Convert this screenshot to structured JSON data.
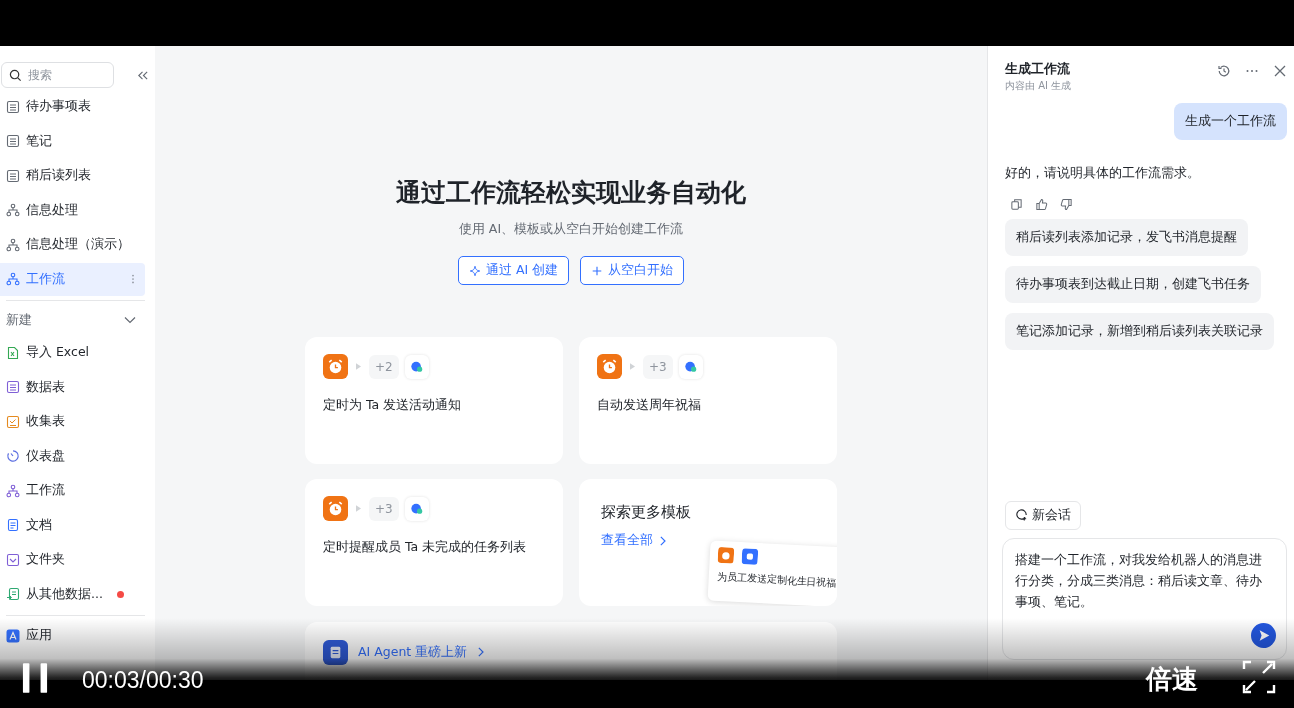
{
  "sidebar": {
    "search": {
      "placeholder": "搜索"
    },
    "items": [
      {
        "label": "待办事项表",
        "kind": "table",
        "selected": false
      },
      {
        "label": "笔记",
        "kind": "table",
        "selected": false
      },
      {
        "label": "稍后读列表",
        "kind": "table",
        "selected": false
      },
      {
        "label": "信息处理",
        "kind": "workflow",
        "selected": false
      },
      {
        "label": "信息处理（演示）",
        "kind": "workflow",
        "selected": false
      },
      {
        "label": "工作流",
        "kind": "workflow",
        "selected": true
      }
    ],
    "new_section": {
      "title": "新建",
      "expanded": true,
      "items": [
        {
          "label": "导入 Excel",
          "kind": "excel",
          "notify": false
        },
        {
          "label": "数据表",
          "kind": "datasheet",
          "notify": false
        },
        {
          "label": "收集表",
          "kind": "form",
          "notify": false
        },
        {
          "label": "仪表盘",
          "kind": "dashboard",
          "notify": false
        },
        {
          "label": "工作流",
          "kind": "workflow",
          "notify": false
        },
        {
          "label": "文档",
          "kind": "doc",
          "notify": false
        },
        {
          "label": "文件夹",
          "kind": "folder",
          "notify": false
        },
        {
          "label": "从其他数据...",
          "kind": "import",
          "notify": true
        }
      ]
    },
    "bottom_item": {
      "label": "应用"
    }
  },
  "main": {
    "title": "通过工作流轻松实现业务自动化",
    "subtitle": "使用 AI、模板或从空白开始创建工作流",
    "buttons": [
      {
        "label": "通过 AI 创建",
        "kind": "ai"
      },
      {
        "label": "从空白开始",
        "kind": "plus"
      }
    ],
    "templates": [
      {
        "count": "+2",
        "label": "定时为 Ta 发送活动通知"
      },
      {
        "count": "+3",
        "label": "自动发送周年祝福"
      },
      {
        "count": "+3",
        "label": "定时提醒成员 Ta 未完成的任务列表"
      }
    ],
    "explore": {
      "title": "探索更多模板",
      "link": "查看全部",
      "preview_caption": "为员工发送定制化生日祝福"
    },
    "banner": {
      "label": "AI Agent 重磅上新"
    }
  },
  "panel": {
    "title": "生成工作流",
    "subtitle": "内容由 AI 生成",
    "messages": [
      {
        "kind": "user",
        "text": "生成一个工作流"
      },
      {
        "kind": "assistant",
        "text": "好的，请说明具体的工作流需求。"
      }
    ],
    "suggestions": [
      "稍后读列表添加记录，发飞书消息提醒",
      "待办事项表到达截止日期，创建飞书任务",
      "笔记添加记录，新增到稍后读列表关联记录"
    ],
    "new_chat": "新会话",
    "input": {
      "value": "搭建一个工作流，对我发给机器人的消息进行分类，分成三类消息：稍后读文章、待办事项、笔记。"
    }
  },
  "player": {
    "playing": true,
    "time": "00:03/00:30",
    "speed": "倍速"
  }
}
